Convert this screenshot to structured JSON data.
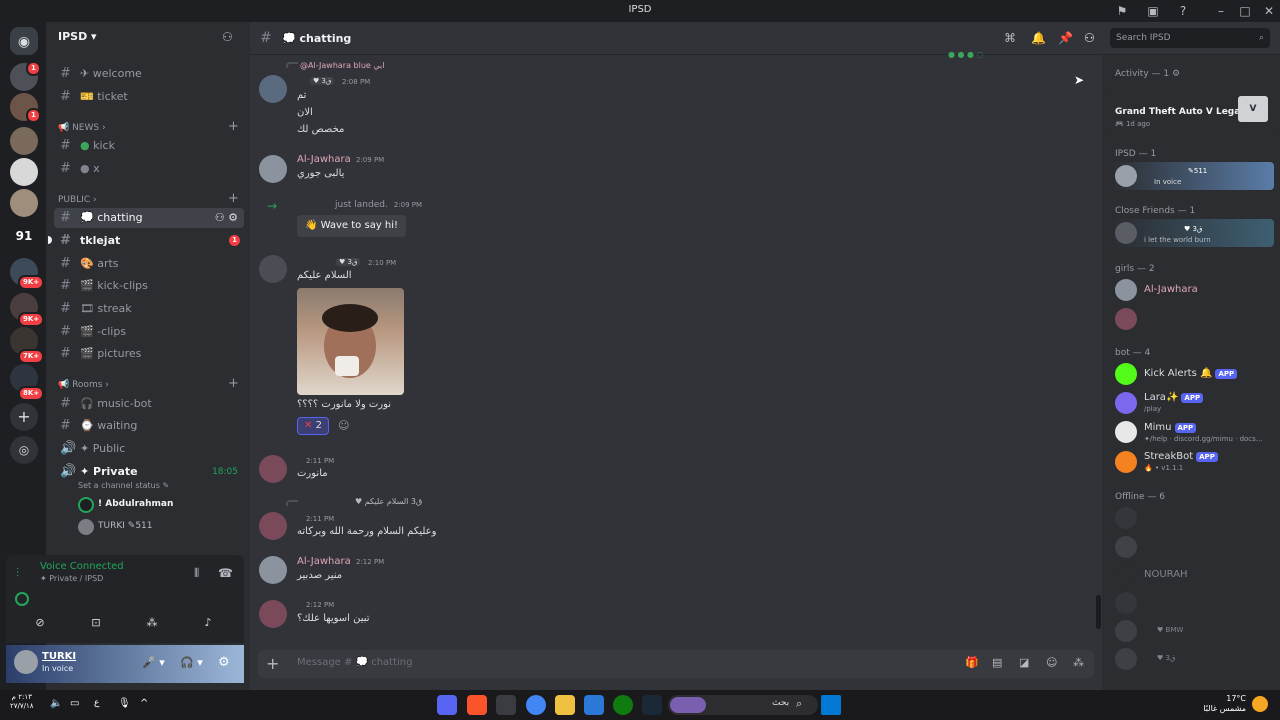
{
  "window": {
    "title": "IPSD"
  },
  "server": {
    "name": "IPSD"
  },
  "rail_badges": [
    "1",
    "1",
    "1",
    "9K+",
    "9K+",
    "7K+",
    "8K+"
  ],
  "rail_number": "91",
  "channels": {
    "top": [
      {
        "icon": "✈",
        "label": "welcome"
      },
      {
        "icon": "🎫",
        "label": "ticket"
      }
    ],
    "news_label": "NEWS",
    "news": [
      {
        "label": "kick"
      },
      {
        "label": "x"
      }
    ],
    "public_label": "PUBLIC",
    "public": [
      {
        "label": "chatting"
      },
      {
        "label": "tklejat",
        "badge": "1"
      },
      {
        "label": "arts"
      },
      {
        "label": "kick-clips"
      },
      {
        "label": "streak"
      },
      {
        "label": "-clips"
      },
      {
        "label": "pictures"
      }
    ],
    "rooms_label": "Rooms",
    "rooms": [
      {
        "label": "music-bot"
      },
      {
        "label": "waiting"
      },
      {
        "label": "Public"
      },
      {
        "label": "Private",
        "time": "18:05"
      }
    ],
    "channel_status_placeholder": "Set a channel status",
    "voice_users": [
      "! Abdulrahman",
      "TURKI"
    ],
    "voice_user_tag": "511"
  },
  "voice_panel": {
    "status": "Voice Connected",
    "location": "Private / IPSD"
  },
  "user_panel": {
    "name": "TURKI",
    "status": "In voice"
  },
  "header": {
    "channel": "chatting",
    "search_placeholder": "Search IPSD"
  },
  "messages": [
    {
      "reply": "@Al-Jawhara blue ابي",
      "tag": "ق3",
      "time": "2:08 PM",
      "lines": [
        "تم",
        "الان",
        "مخصص لك"
      ]
    },
    {
      "author": "Al-Jawhara",
      "time": "2:09 PM",
      "lines": [
        "يالبى جوري"
      ]
    },
    {
      "system": "just landed.",
      "time": "2:09 PM",
      "button": "Wave to say hi!"
    },
    {
      "tag": "ق3",
      "time": "2:10 PM",
      "lines": [
        "السلام عليكم"
      ],
      "caption": "نورت ولا مانورت ؟؟؟؟",
      "reaction_count": "2"
    },
    {
      "time": "2:11 PM",
      "lines": [
        "مانورت"
      ]
    },
    {
      "reply": "السلام عليكم",
      "reply_tag": "ق3",
      "time": "2:11 PM",
      "lines": [
        "وعليكم السلام ورحمة الله وبركاته"
      ]
    },
    {
      "author": "Al-Jawhara",
      "time": "2:12 PM",
      "lines": [
        "منير صدبير"
      ]
    },
    {
      "time": "2:12 PM",
      "lines": [
        "تبين اسويها علك؟"
      ]
    }
  ],
  "composer": {
    "placeholder": "Message # 💭 chatting"
  },
  "members": {
    "activity_label": "Activity — 1",
    "activity_game": "Grand Theft Auto V Legacy",
    "activity_ago": "1d ago",
    "ipsd_label": "IPSD — 1",
    "ipsd_member_status": "In voice",
    "ipsd_member_tag": "511",
    "close_label": "Close Friends — 1",
    "close_member_status": "i let the world burn",
    "close_member_tag": "ق3",
    "girls_label": "girls — 2",
    "girls": [
      "Al-Jawhara"
    ],
    "bot_label": "bot — 4",
    "bots": [
      {
        "name": "Kick Alerts",
        "sub": ""
      },
      {
        "name": "Lara",
        "sub": "/play"
      },
      {
        "name": "Mimu",
        "sub": "/help · discord.gg/mimu · docs..."
      },
      {
        "name": "StreakBot",
        "sub": "v1.1.1"
      }
    ],
    "app_badge": "APP",
    "offline_label": "Offline — 6",
    "offline": [
      "NOURAH"
    ],
    "offline_tags": [
      "BMW",
      "ق3"
    ]
  },
  "taskbar": {
    "clock_time": "٢:١٣ م",
    "clock_date": "٢٧/٧/١٨",
    "weather_temp": "17°C",
    "weather_desc": "مشمس غالبًا",
    "search_label": "بحث",
    "lang": "ع"
  }
}
